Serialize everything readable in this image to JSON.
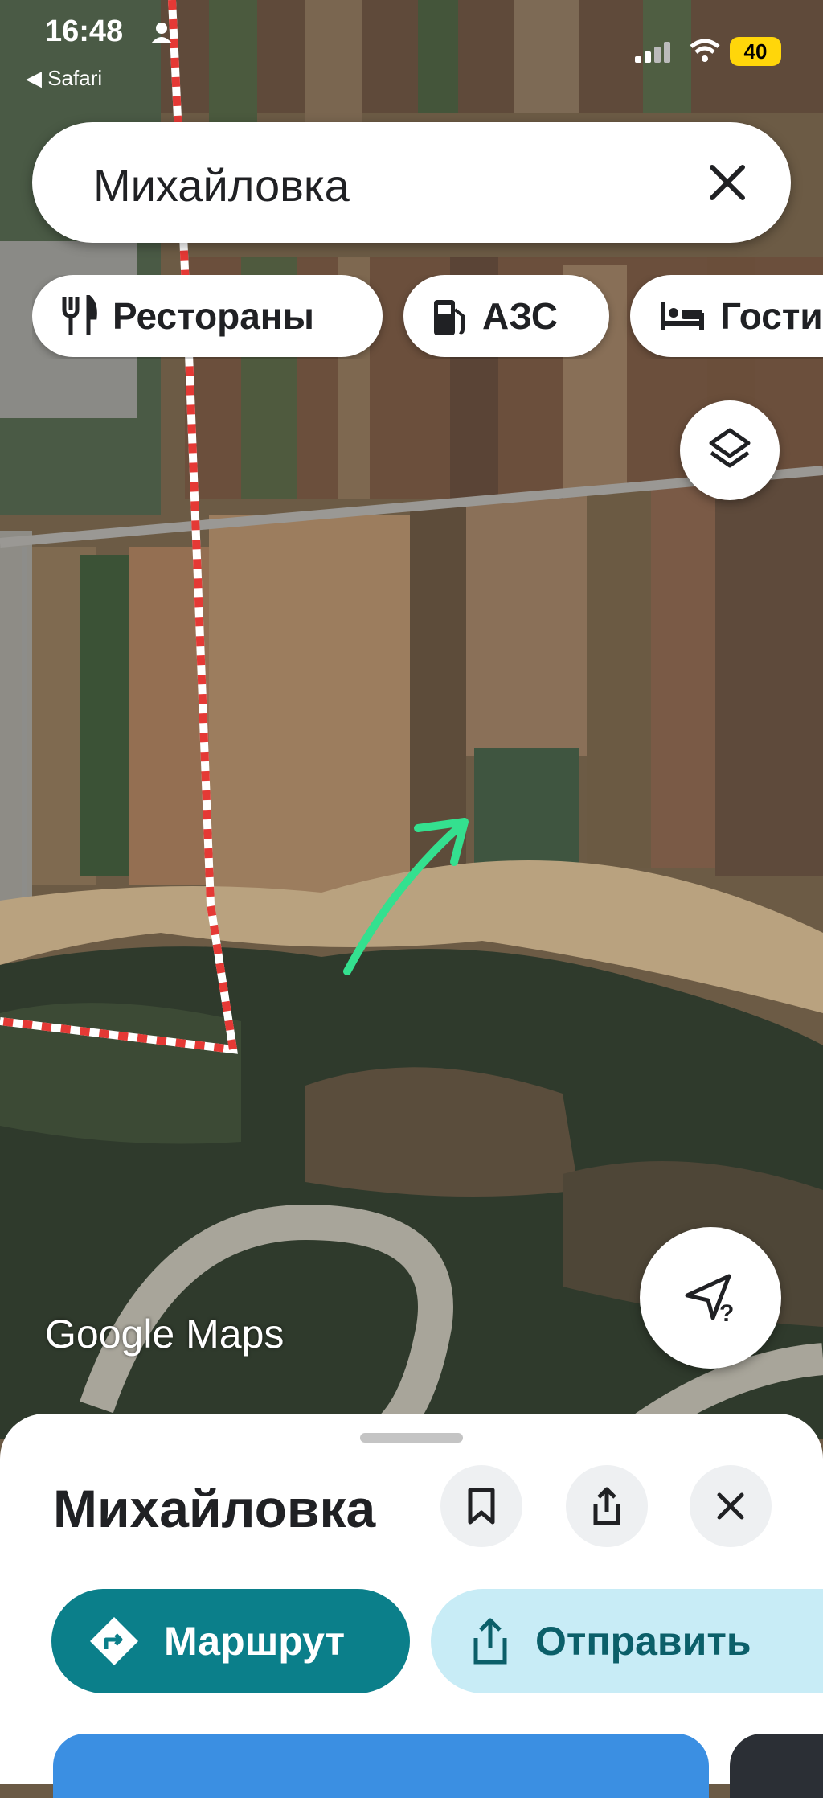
{
  "status_bar": {
    "time": "16:48",
    "back_label": "◀ Safari",
    "battery": "40"
  },
  "search": {
    "query": "Михайловка"
  },
  "chips": [
    {
      "label": "Рестораны",
      "icon": "restaurant-icon"
    },
    {
      "label": "АЗС",
      "icon": "gas-station-icon"
    },
    {
      "label": "Гостиницы",
      "icon": "hotel-icon"
    }
  ],
  "map": {
    "logo": "Google Maps",
    "boundary_color": "#e53935",
    "arrow_color": "#34e08f"
  },
  "sheet": {
    "title": "Михайловка",
    "route_label": "Маршрут",
    "share_label": "Отправить"
  },
  "colors": {
    "accent": "#0b7f8a",
    "share_bg": "#c8ecf6"
  }
}
